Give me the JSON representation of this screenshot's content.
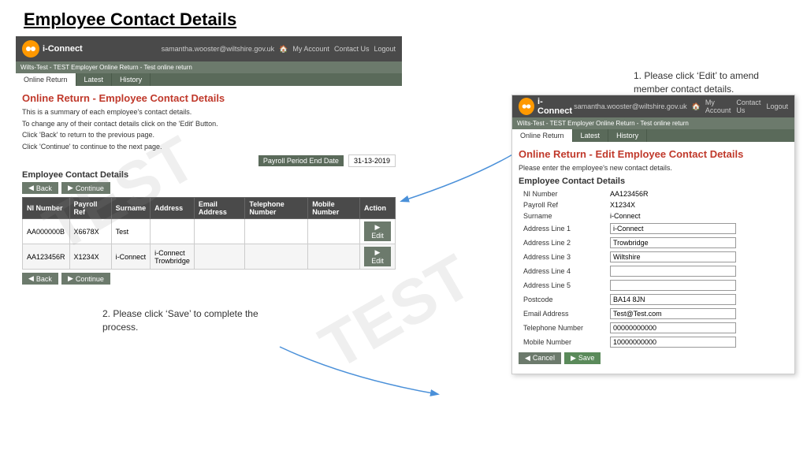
{
  "page": {
    "title": "Employee Contact Details"
  },
  "panel1": {
    "logo": "i-Connect",
    "user_email": "samantha.wooster@wiltshire.gov.uk",
    "nav_links": [
      "My Account",
      "Contact Us",
      "Logout"
    ],
    "breadcrumb": "Wilts-Test - TEST Employer Online Return - Test online return",
    "tabs": [
      "Online Return",
      "Latest",
      "History"
    ],
    "section_title": "Online Return - Employee Contact Details",
    "description_lines": [
      "This is a summary of each employee's contact details.",
      "To change any of their contact details click on the 'Edit' Button.",
      "Click 'Back' to return to the previous page.",
      "Click 'Continue' to continue to the next page."
    ],
    "payroll_period_label": "Payroll Period End Date",
    "payroll_period_value": "31-13-2019",
    "subsection_title": "Employee Contact Details",
    "btn_back": "Back",
    "btn_continue": "Continue",
    "table": {
      "headers": [
        "NI Number",
        "Payroll Ref",
        "Surname",
        "Address",
        "Email Address",
        "Telephone Number",
        "Mobile Number",
        "Action"
      ],
      "rows": [
        {
          "ni": "AA000000B",
          "payroll": "X6678X",
          "surname": "Test",
          "address": "",
          "email": "",
          "tel": "",
          "mobile": ""
        },
        {
          "ni": "AA123456R",
          "payroll": "X1234X",
          "surname": "i-Connect",
          "address": "i-Connect\nTrowbridge",
          "email": "",
          "tel": "",
          "mobile": ""
        }
      ]
    },
    "btn_edit": "Edit"
  },
  "panel2": {
    "logo": "i-Connect",
    "user_email": "samantha.wooster@wiltshire.gov.uk",
    "nav_links": [
      "My Account",
      "Contact Us",
      "Logout"
    ],
    "breadcrumb": "Wilts-Test - TEST Employer Online Return - Test online return",
    "tabs": [
      "Online Return",
      "Latest",
      "History"
    ],
    "section_title": "Online Return - Edit Employee Contact Details",
    "description": "Please enter the employee's new contact details.",
    "subsection_title": "Employee Contact Details",
    "fields": [
      {
        "label": "NI Number",
        "value": "AA123456R",
        "is_input": false
      },
      {
        "label": "Payroll Ref",
        "value": "X1234X",
        "is_input": false
      },
      {
        "label": "Surname",
        "value": "i-Connect",
        "is_input": false
      },
      {
        "label": "Address Line 1",
        "value": "i-Connect",
        "is_input": true
      },
      {
        "label": "Address Line 2",
        "value": "Trowbridge",
        "is_input": true
      },
      {
        "label": "Address Line 3",
        "value": "Wiltshire",
        "is_input": true
      },
      {
        "label": "Address Line 4",
        "value": "",
        "is_input": true
      },
      {
        "label": "Address Line 5",
        "value": "",
        "is_input": true
      },
      {
        "label": "Postcode",
        "value": "BA14 8JN",
        "is_input": true
      },
      {
        "label": "Email Address",
        "value": "Test@Test.com",
        "is_input": true
      },
      {
        "label": "Telephone Number",
        "value": "00000000000",
        "is_input": true
      },
      {
        "label": "Mobile Number",
        "value": "10000000000",
        "is_input": true
      }
    ],
    "btn_cancel": "Cancel",
    "btn_save": "Save"
  },
  "annotations": {
    "note1": "1. Please click ‘Edit’ to amend member contact details.",
    "note2": "2. Please click ‘Save’ to complete the process."
  },
  "watermark_text": "TEST"
}
